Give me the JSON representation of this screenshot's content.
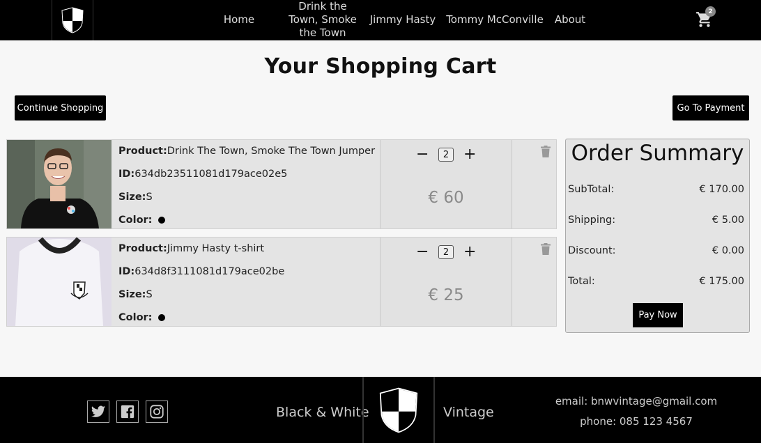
{
  "nav": {
    "links": [
      "Home",
      "Drink the Town, Smoke the Town",
      "Jimmy Hasty",
      "Tommy McConville",
      "About"
    ],
    "cart_count": "2"
  },
  "page": {
    "title": "Your Shopping Cart",
    "continue_label": "Continue Shopping",
    "payment_label": "Go To Payment"
  },
  "labels": {
    "product": "Product:",
    "id": "ID:",
    "size": "Size:",
    "color": "Color:"
  },
  "items": [
    {
      "product": "Drink The Town, Smoke The Town Jumper",
      "id": "634db23511081d179ace02e5",
      "size": "S",
      "color": "#000000",
      "qty": "2",
      "price": "€ 60"
    },
    {
      "product": "Jimmy Hasty t-shirt",
      "id": "634d8f3111081d179ace02be",
      "size": "S",
      "color": "#000000",
      "qty": "2",
      "price": "€ 25"
    }
  ],
  "summary": {
    "title": "Order Summary",
    "rows": [
      {
        "label": "SubTotal:",
        "value": "€ 170.00"
      },
      {
        "label": "Shipping:",
        "value": "€ 5.00"
      },
      {
        "label": "Discount:",
        "value": "€ 0.00"
      },
      {
        "label": "Total:",
        "value": "€ 175.00"
      }
    ],
    "pay_label": "Pay Now"
  },
  "footer": {
    "brand_left": "Black & White",
    "brand_right": "Vintage",
    "email": "email: bnwvintage@gmail.com",
    "phone": "phone: 085 123 4567",
    "social": [
      "twitter-icon",
      "facebook-icon",
      "instagram-icon"
    ]
  },
  "colors": {
    "background": "#f7f7f7",
    "nav_bg": "#000000",
    "panel": "#e4e4e4",
    "price_grey": "#8a8a8a"
  }
}
